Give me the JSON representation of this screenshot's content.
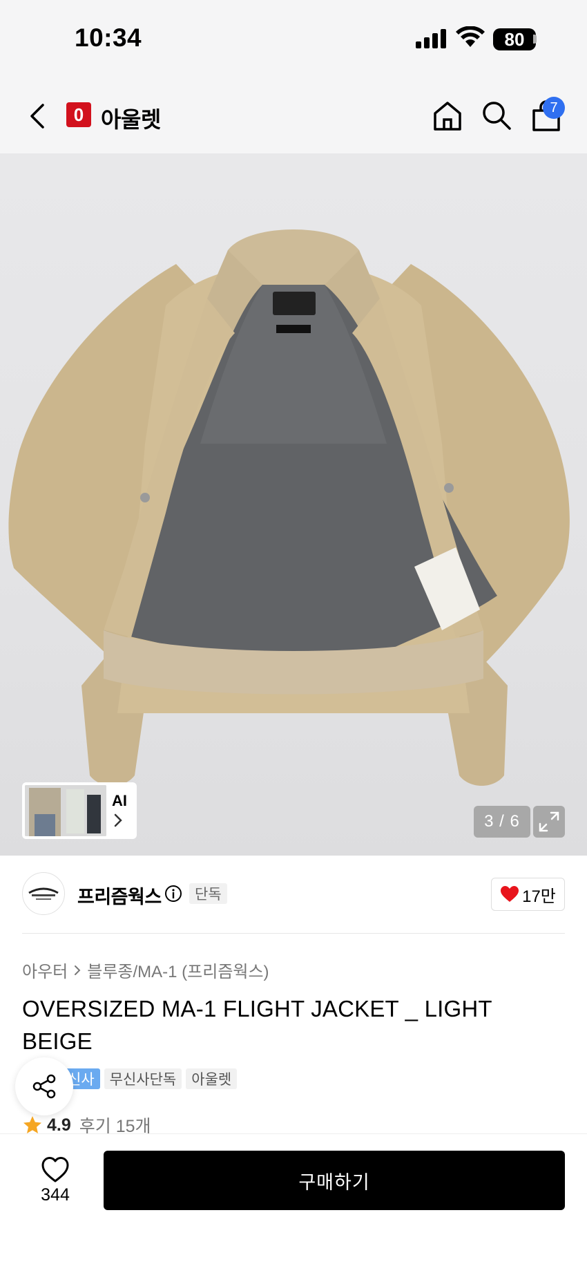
{
  "status_bar": {
    "time": "10:34",
    "battery": "80"
  },
  "nav": {
    "brand_logo_letter": "0",
    "brand_name": "아울렛",
    "cart_count": "7",
    "icons": [
      "back-icon",
      "home-icon",
      "search-icon",
      "shopping-bag-icon"
    ]
  },
  "gallery": {
    "counter": "3 / 6",
    "ai_label": "AI"
  },
  "brand": {
    "name": "프리즘웍스",
    "exclusive_badge": "단독",
    "like_count": "17만"
  },
  "product": {
    "breadcrumb": [
      "아우터",
      "블루종/MA-1 (프리즘웍스)"
    ],
    "title": "OVERSIZED MA-1 FLIGHT JACKET _ LIGHT BEIGE",
    "tags": [
      "신사",
      "무신사단독",
      "아울렛"
    ],
    "rating": "4.9",
    "review_link": "후기 15개"
  },
  "bottom_bar": {
    "wish_count": "344",
    "buy_label": "구매하기"
  },
  "colors": {
    "brand_red": "#d2111d",
    "badge_blue": "#2f6ff0",
    "tag_blue": "#6aaaf0",
    "heart_red": "#e8141c",
    "star": "#f5a623"
  }
}
